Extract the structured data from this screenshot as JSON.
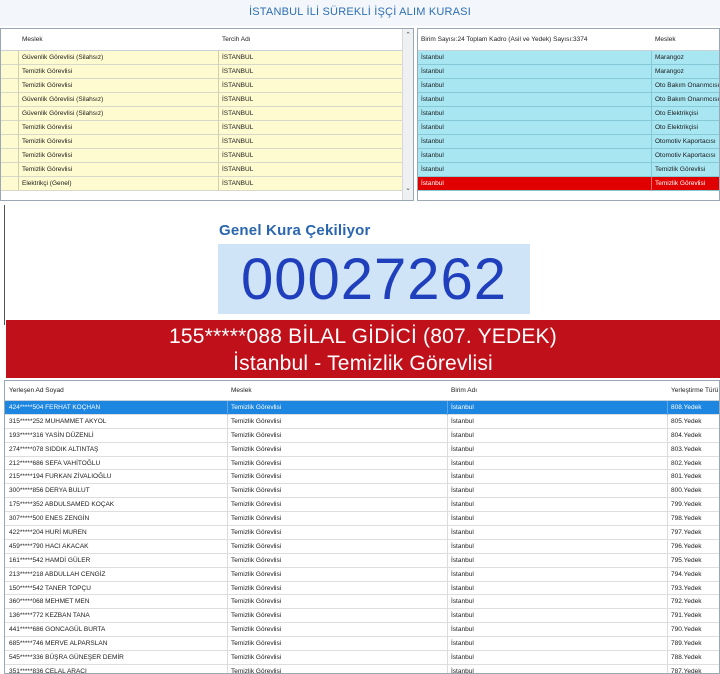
{
  "header": {
    "title": "İSTANBUL İLİ SÜREKLİ İŞÇİ ALIM KURASI"
  },
  "top_left_grid": {
    "columns": [
      "Meslek",
      "Tercih Adı"
    ],
    "rows": [
      [
        "Güvenlik Görevlisi (Silahsız)",
        "İSTANBUL"
      ],
      [
        "Temizlik Görevlisi",
        "İSTANBUL"
      ],
      [
        "Temizlik Görevlisi",
        "İSTANBUL"
      ],
      [
        "Güvenlik Görevlisi (Silahsız)",
        "İSTANBUL"
      ],
      [
        "Güvenlik Görevlisi (Silahsız)",
        "İSTANBUL"
      ],
      [
        "Temizlik Görevlisi",
        "İSTANBUL"
      ],
      [
        "Temizlik Görevlisi",
        "İSTANBUL"
      ],
      [
        "Temizlik Görevlisi",
        "İSTANBUL"
      ],
      [
        "Temizlik Görevlisi",
        "İSTANBUL"
      ],
      [
        "Elektrikçi (Genel)",
        "İSTANBUL"
      ]
    ]
  },
  "top_right_grid": {
    "columns": [
      "Birim Sayısı:24 Toplam Kadro (Asil ve Yedek) Sayısı:3374",
      "Meslek"
    ],
    "rows": [
      [
        "İstanbul",
        "Marangoz"
      ],
      [
        "İstanbul",
        "Marangoz"
      ],
      [
        "İstanbul",
        "Oto Bakım Onarımcısı (Genel)"
      ],
      [
        "İstanbul",
        "Oto Bakım Onarımcısı (Genel)"
      ],
      [
        "İstanbul",
        "Oto Elektrikçisi"
      ],
      [
        "İstanbul",
        "Oto Elektrikçisi"
      ],
      [
        "İstanbul",
        "Otomotiv Kaportacısı"
      ],
      [
        "İstanbul",
        "Otomotiv Kaportacısı"
      ],
      [
        "İstanbul",
        "Temizlik Görevlisi"
      ],
      [
        "İstanbul",
        "Temizlik Görevlisi"
      ]
    ],
    "highlight_index": 9
  },
  "draw": {
    "label": "Genel Kura Çekiliyor",
    "counter": "00027262",
    "winner_line1": "155*****088 BİLAL GİDİCİ (807. YEDEK)",
    "winner_line2": "İstanbul - Temizlik Görevlisi"
  },
  "bottom_grid": {
    "columns": [
      "Yerleşen Ad Soyad",
      "Meslek",
      "Birim Adı",
      "Yerleştirme Türü"
    ],
    "rows": [
      [
        "424*****504 FERHAT KOÇHAN",
        "Temizlik Görevlisi",
        "İstanbul",
        "808.Yedek"
      ],
      [
        "315*****252 MUHAMMET AKYOL",
        "Temizlik Görevlisi",
        "İstanbul",
        "805.Yedek"
      ],
      [
        "193*****316 YASİN DÜZENLİ",
        "Temizlik Görevlisi",
        "İstanbul",
        "804.Yedek"
      ],
      [
        "274*****078 SIDDIK ALTINTAŞ",
        "Temizlik Görevlisi",
        "İstanbul",
        "803.Yedek"
      ],
      [
        "212*****686 SEFA VAHİTOĞLU",
        "Temizlik Görevlisi",
        "İstanbul",
        "802.Yedek"
      ],
      [
        "215*****194 FURKAN ZİVALIOĞLU",
        "Temizlik Görevlisi",
        "İstanbul",
        "801.Yedek"
      ],
      [
        "300*****856 DERYA BULUT",
        "Temizlik Görevlisi",
        "İstanbul",
        "800.Yedek"
      ],
      [
        "175*****352 ABDULSAMED KOÇAK",
        "Temizlik Görevlisi",
        "İstanbul",
        "799.Yedek"
      ],
      [
        "307*****500 ENES ZENGİN",
        "Temizlik Görevlisi",
        "İstanbul",
        "798.Yedek"
      ],
      [
        "422*****204 HURİ MUREN",
        "Temizlik Görevlisi",
        "İstanbul",
        "797.Yedek"
      ],
      [
        "459*****790 HACI AKACAK",
        "Temizlik Görevlisi",
        "İstanbul",
        "796.Yedek"
      ],
      [
        "161*****542 HAMDİ GÜLER",
        "Temizlik Görevlisi",
        "İstanbul",
        "795.Yedek"
      ],
      [
        "213*****218 ABDULLAH CENGİZ",
        "Temizlik Görevlisi",
        "İstanbul",
        "794.Yedek"
      ],
      [
        "150*****542 TANER TOPÇU",
        "Temizlik Görevlisi",
        "İstanbul",
        "793.Yedek"
      ],
      [
        "360*****068 MEHMET MEN",
        "Temizlik Görevlisi",
        "İstanbul",
        "792.Yedek"
      ],
      [
        "136*****772 KEZBAN TANA",
        "Temizlik Görevlisi",
        "İstanbul",
        "791.Yedek"
      ],
      [
        "441*****686 GONCAGÜL BURTA",
        "Temizlik Görevlisi",
        "İstanbul",
        "790.Yedek"
      ],
      [
        "685*****746 MERVE ALPARSLAN",
        "Temizlik Görevlisi",
        "İstanbul",
        "789.Yedek"
      ],
      [
        "545*****336 BÜŞRA GÜNEŞER DEMİR",
        "Temizlik Görevlisi",
        "İstanbul",
        "788.Yedek"
      ],
      [
        "351*****836 CELAL ARACI",
        "Temizlik Görevlisi",
        "İstanbul",
        "787.Yedek"
      ]
    ],
    "selected_index": 0
  },
  "colors": {
    "accent": "#2a66b0",
    "counter_text": "#1f3fbd",
    "counter_bg": "#cfe4f7",
    "winner_bg": "#c0101a",
    "left_grid_row": "#fffbd0",
    "right_grid_row": "#a8e6f2",
    "highlight_red": "#e00000",
    "selection_blue": "#1c86e0"
  }
}
